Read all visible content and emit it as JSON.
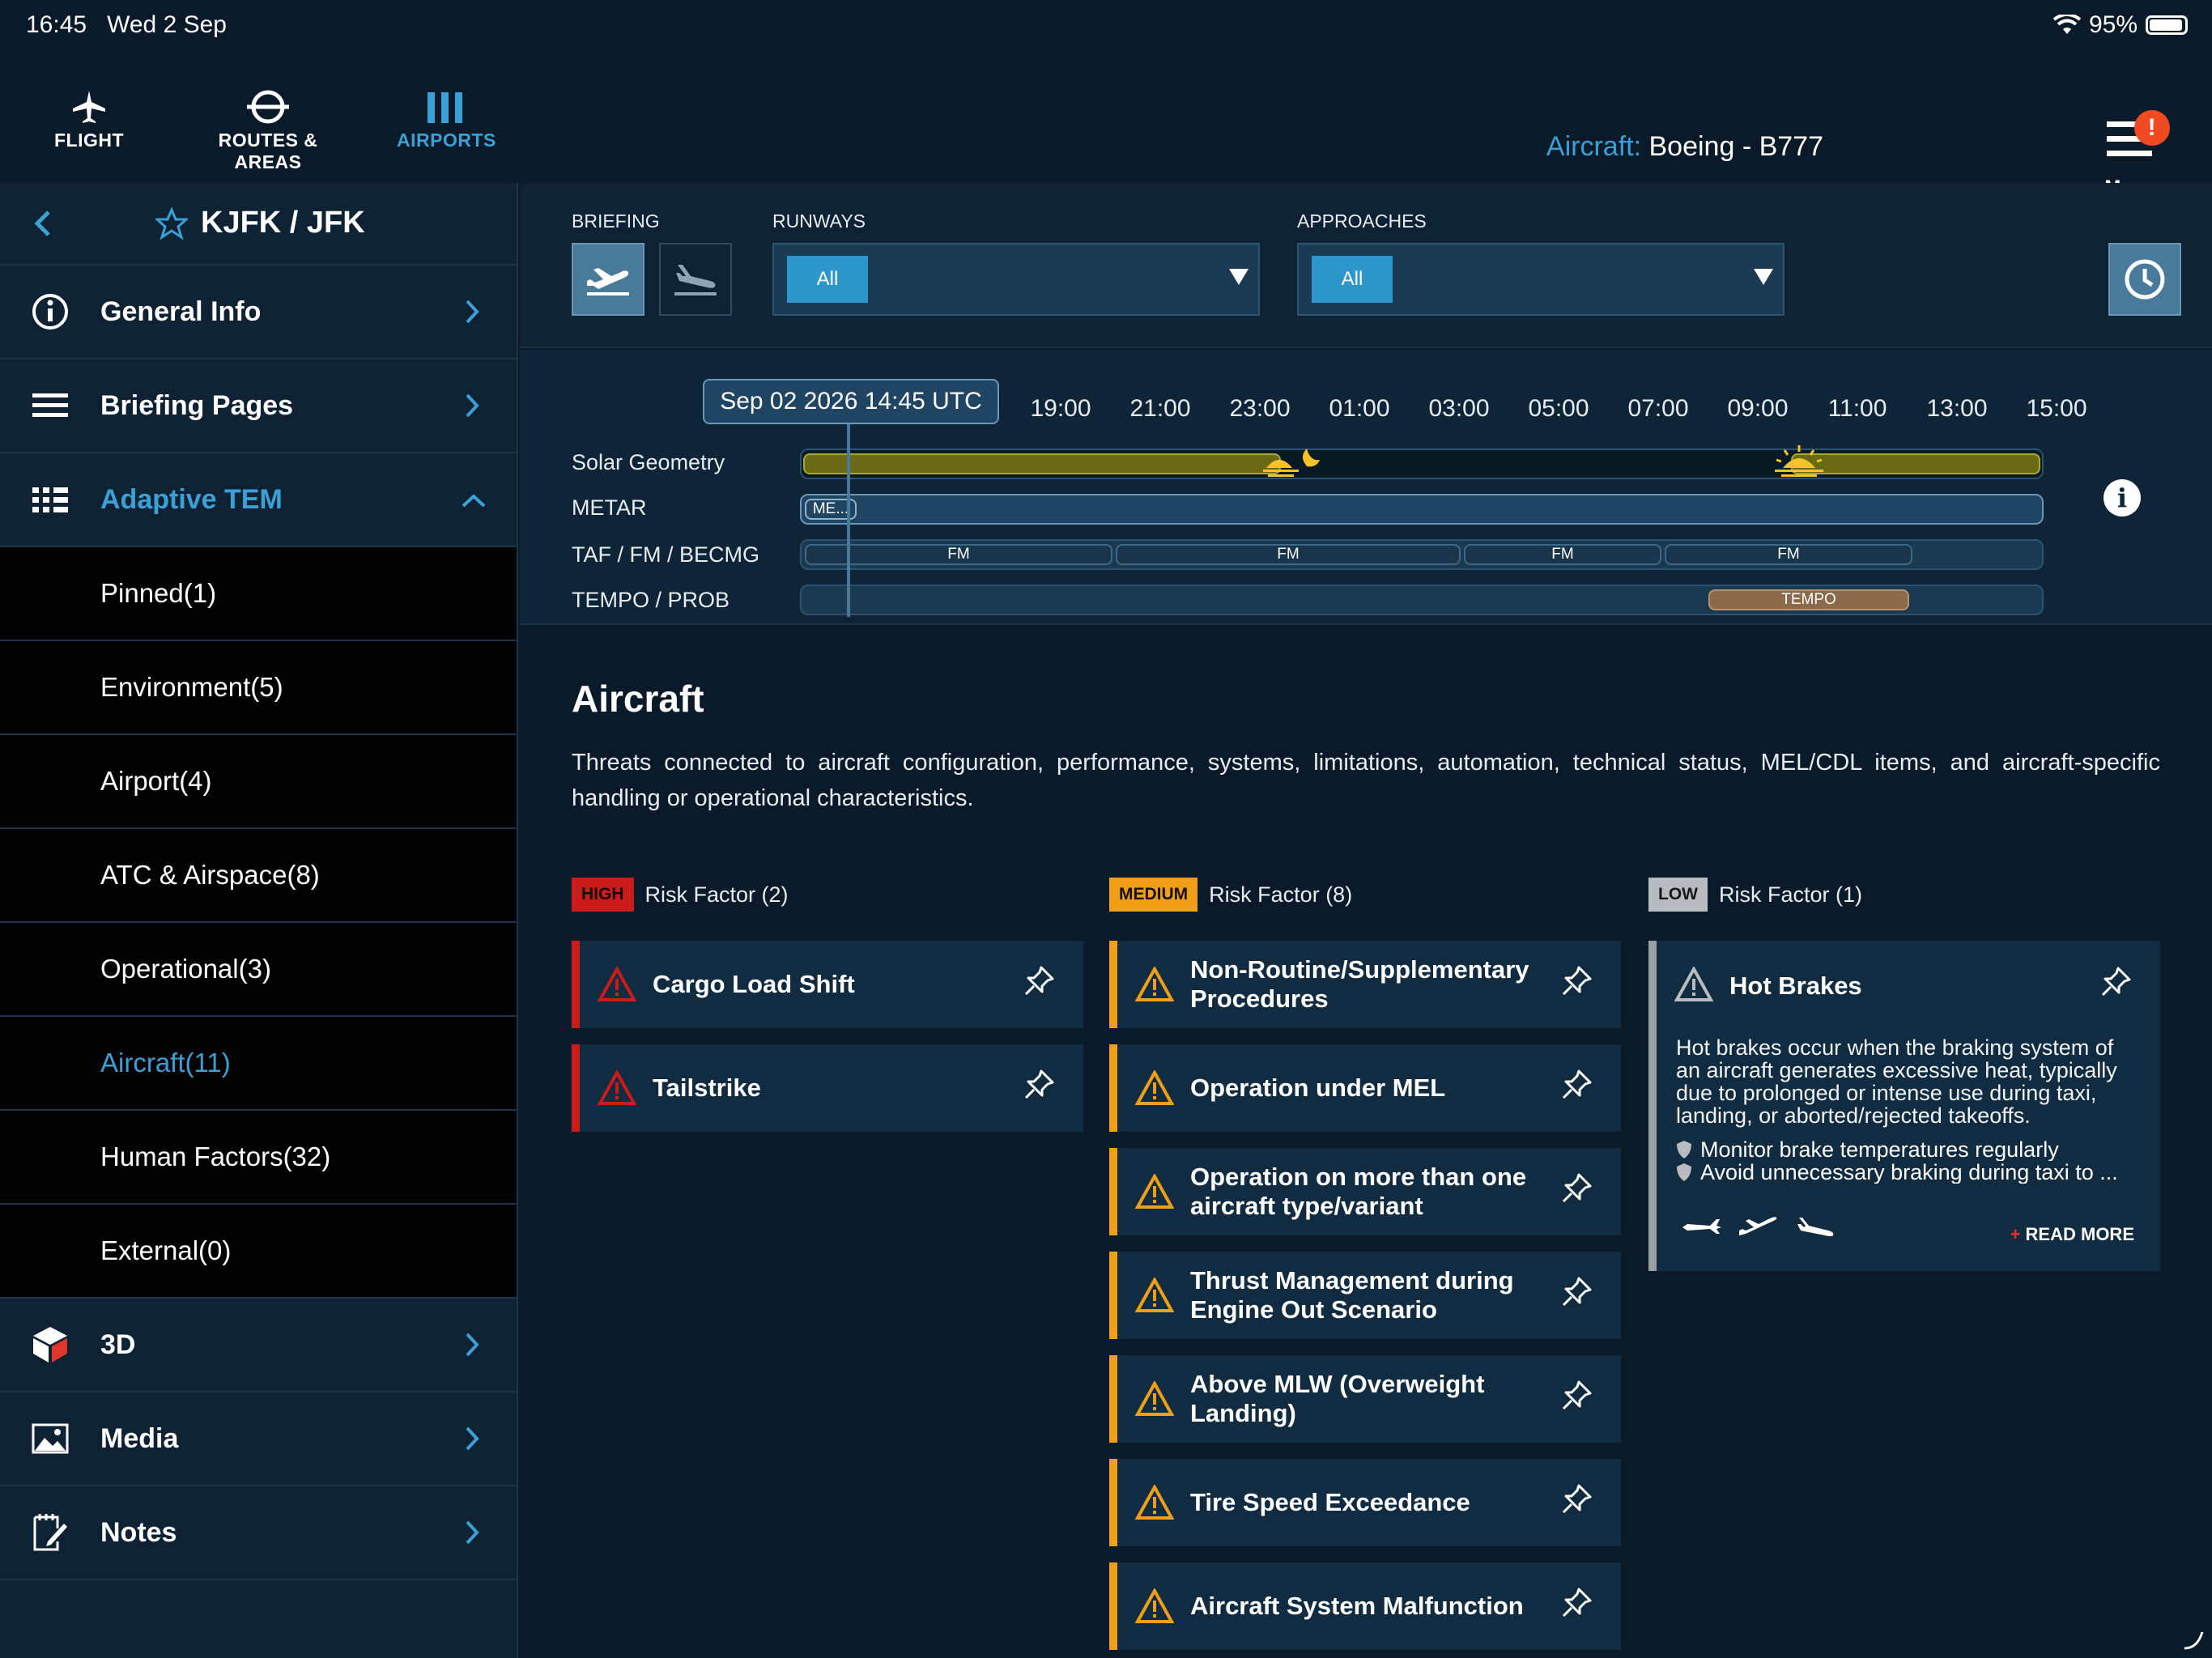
{
  "status": {
    "time": "16:45",
    "date": "Wed 2 Sep",
    "battery": "95%"
  },
  "nav": {
    "flight": "FLIGHT",
    "routes": "ROUTES & AREAS",
    "airports": "AIRPORTS",
    "aircraft_key": "Aircraft:",
    "aircraft_value": "Boeing - B777",
    "menu": "Menu",
    "menu_badge": "!"
  },
  "sidebar": {
    "title": "KJFK / JFK",
    "general_info": "General Info",
    "briefing_pages": "Briefing Pages",
    "adaptive_tem": "Adaptive TEM",
    "sub": [
      "Pinned(1)",
      "Environment(5)",
      "Airport(4)",
      "ATC & Airspace(8)",
      "Operational(3)",
      "Aircraft(11)",
      "Human Factors(32)",
      "External(0)"
    ],
    "three_d": "3D",
    "media": "Media",
    "notes": "Notes"
  },
  "briefing": {
    "briefing_label": "BRIEFING",
    "runways_label": "RUNWAYS",
    "runways_value": "All",
    "approaches_label": "APPROACHES",
    "approaches_value": "All"
  },
  "timeline": {
    "now": "Sep 02 2026 14:45 UTC",
    "ticks": [
      "19:00",
      "21:00",
      "23:00",
      "01:00",
      "03:00",
      "05:00",
      "07:00",
      "09:00",
      "11:00",
      "13:00",
      "15:00"
    ],
    "rows": [
      "Solar Geometry",
      "METAR",
      "TAF / FM / BECMG",
      "TEMPO / PROB"
    ],
    "metar_seg": "ME...",
    "fm": "FM",
    "tempo": "TEMPO",
    "info": "i"
  },
  "section": {
    "title": "Aircraft",
    "description": "Threats connected to aircraft configuration, performance, systems, limitations, automation, technical status, MEL/CDL items, and aircraft-specific handling or operational characteristics."
  },
  "risk": {
    "high": {
      "badge": "HIGH",
      "label": "Risk Factor (2)",
      "items": [
        "Cargo Load Shift",
        "Tailstrike"
      ]
    },
    "medium": {
      "badge": "MEDIUM",
      "label": "Risk Factor (8)",
      "items": [
        "Non-Routine/Supplementary Procedures",
        "Operation under MEL",
        "Operation on more than one aircraft type/variant",
        "Thrust Management during Engine Out Scenario",
        "Above MLW (Overweight Landing)",
        "Tire Speed Exceedance",
        "Aircraft System Malfunction"
      ]
    },
    "low": {
      "badge": "LOW",
      "label": "Risk Factor (1)",
      "title": "Hot Brakes",
      "body": "Hot brakes occur when the braking system of an aircraft generates excessive heat, typically due to prolonged or intense use during taxi, landing, or aborted/rejected takeoffs.",
      "bullets": [
        "Monitor brake temperatures regularly",
        "Avoid unnecessary braking during taxi to ..."
      ],
      "read_more": "READ MORE",
      "read_more_plus": "+"
    }
  },
  "colors": {
    "accent": "#3aa0d6",
    "high": "#cc1b1b",
    "medium": "#f0a018",
    "low": "#9a9ea2"
  }
}
